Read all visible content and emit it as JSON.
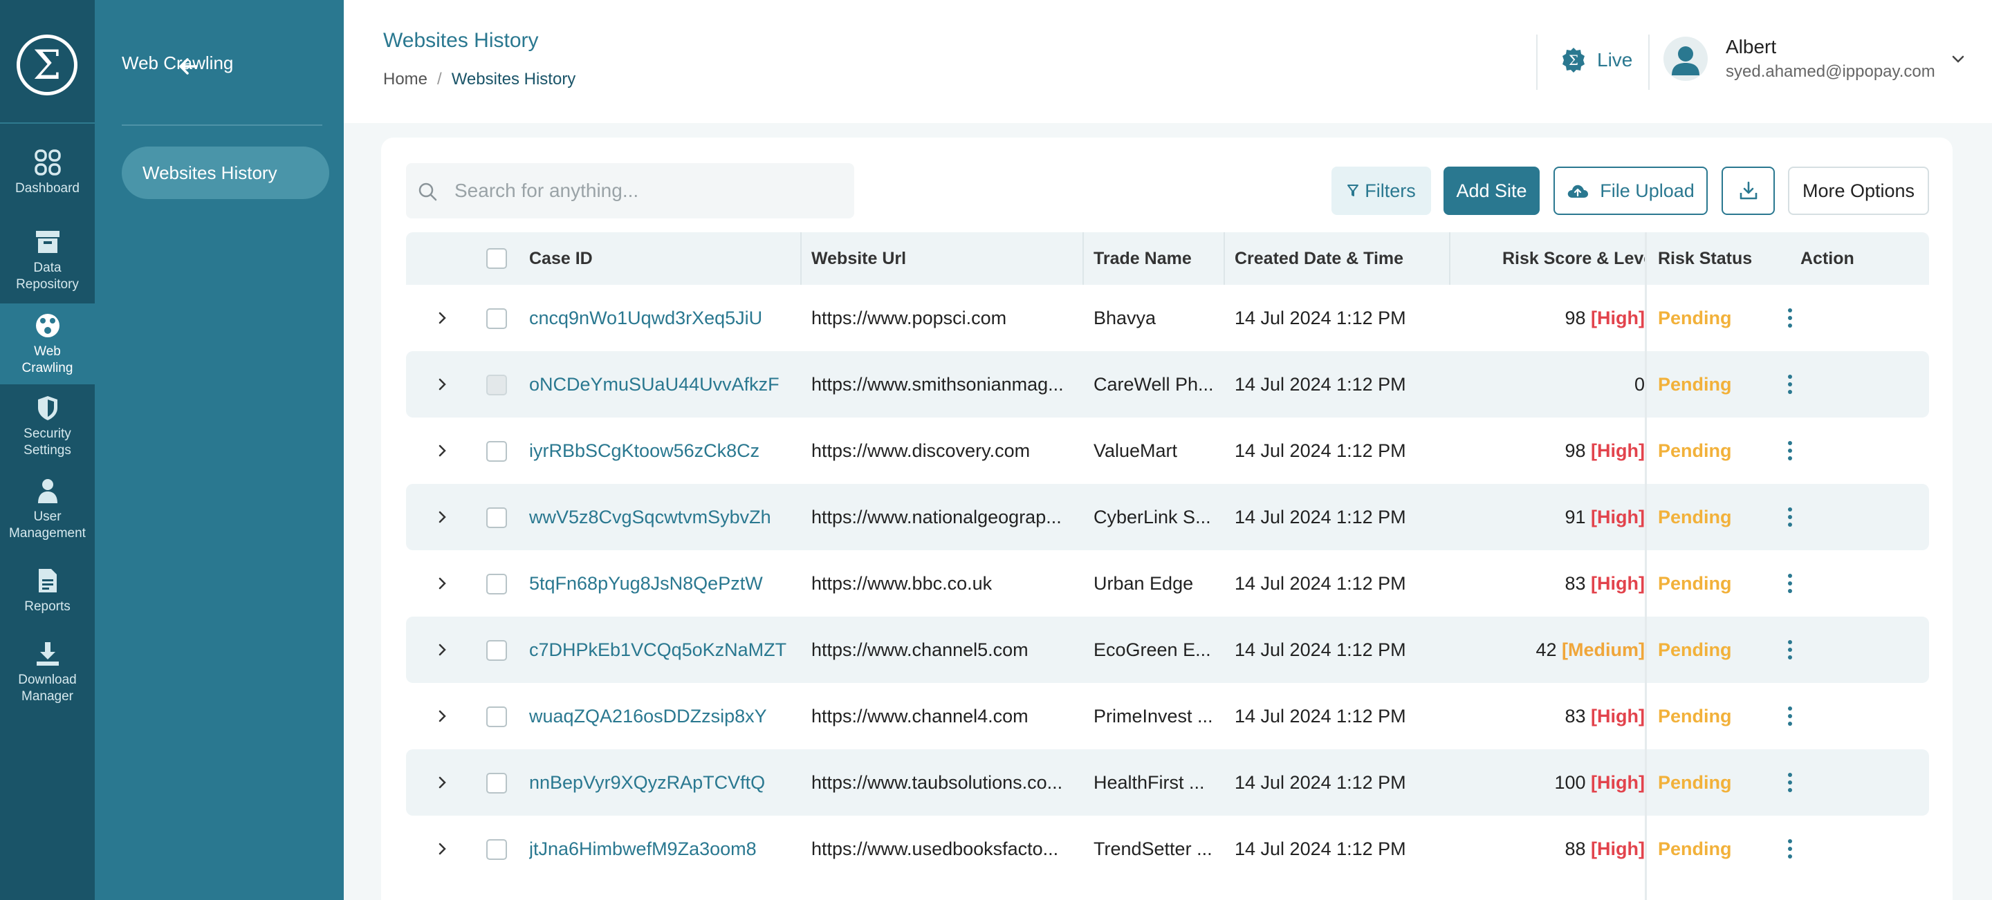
{
  "brand": {
    "logo_glyph": "Σ",
    "accent": "#2a7890",
    "rail_bg": "#1a5468"
  },
  "rail": {
    "items": [
      {
        "label": "Dashboard",
        "icon": "grid-icon"
      },
      {
        "label": "Data Repository",
        "icon": "archive-icon"
      },
      {
        "label": "Web Crawling",
        "icon": "globe-icon",
        "active": true
      },
      {
        "label": "Security Settings",
        "icon": "shield-icon"
      },
      {
        "label": "User Management",
        "icon": "user-icon"
      },
      {
        "label": "Reports",
        "icon": "document-icon"
      },
      {
        "label": "Download Manager",
        "icon": "download-icon"
      }
    ]
  },
  "panel": {
    "title": "Web Crawling",
    "items": [
      {
        "label": "Websites History",
        "active": true
      }
    ]
  },
  "header": {
    "title": "Websites History",
    "breadcrumb": {
      "home": "Home",
      "separator": "/",
      "current": "Websites History"
    },
    "live_label": "Live",
    "user": {
      "name": "Albert",
      "email": "syed.ahamed@ippopay.com"
    }
  },
  "toolbar": {
    "search_placeholder": "Search for anything...",
    "filters_label": "Filters",
    "add_site_label": "Add Site",
    "file_upload_label": "File Upload",
    "more_options_label": "More Options"
  },
  "table": {
    "columns": {
      "case_id": "Case ID",
      "website_url": "Website Url",
      "trade_name": "Trade Name",
      "created": "Created Date & Time",
      "risk": "Risk Score & Level",
      "status": "Risk Status",
      "action": "Action"
    },
    "rows": [
      {
        "case_id": "cncq9nWo1Uqwd3rXeq5JiU",
        "url": "https://www.popsci.com",
        "trade": "Bhavya",
        "created": "14 Jul 2024 1:12 PM",
        "score": "98",
        "level": "[High]",
        "level_kind": "high",
        "status": "Pending"
      },
      {
        "case_id": "oNCDeYmuSUaU44UvvAfkzF",
        "url": "https://www.smithsonianmag...",
        "trade": "CareWell Ph...",
        "created": "14 Jul 2024 1:12 PM",
        "score": "0",
        "level": "",
        "level_kind": "none",
        "status": "Pending",
        "checkbox_disabled": true
      },
      {
        "case_id": "iyrRBbSCgKtoow56zCk8Cz",
        "url": "https://www.discovery.com",
        "trade": "ValueMart",
        "created": "14 Jul 2024 1:12 PM",
        "score": "98",
        "level": "[High]",
        "level_kind": "high",
        "status": "Pending"
      },
      {
        "case_id": "wwV5z8CvgSqcwtvmSybvZh",
        "url": "https://www.nationalgeograp...",
        "trade": "CyberLink S...",
        "created": "14 Jul 2024 1:12 PM",
        "score": "91",
        "level": "[High]",
        "level_kind": "high",
        "status": "Pending"
      },
      {
        "case_id": "5tqFn68pYug8JsN8QePztW",
        "url": "https://www.bbc.co.uk",
        "trade": "Urban Edge",
        "created": "14 Jul 2024 1:12 PM",
        "score": "83",
        "level": "[High]",
        "level_kind": "high",
        "status": "Pending"
      },
      {
        "case_id": "c7DHPkEb1VCQq5oKzNaMZT",
        "url": "https://www.channel5.com",
        "trade": "EcoGreen E...",
        "created": "14 Jul 2024 1:12 PM",
        "score": "42",
        "level": "[Medium]",
        "level_kind": "medium",
        "status": "Pending"
      },
      {
        "case_id": "wuaqZQA216osDDZzsip8xY",
        "url": "https://www.channel4.com",
        "trade": "PrimeInvest ...",
        "created": "14 Jul 2024 1:12 PM",
        "score": "83",
        "level": "[High]",
        "level_kind": "high",
        "status": "Pending"
      },
      {
        "case_id": "nnBepVyr9XQyzRApTCVftQ",
        "url": "https://www.taubsolutions.co...",
        "trade": "HealthFirst ...",
        "created": "14 Jul 2024 1:12 PM",
        "score": "100",
        "level": "[High]",
        "level_kind": "high",
        "status": "Pending"
      },
      {
        "case_id": "jtJna6HimbwefM9Za3oom8",
        "url": "https://www.usedbooksfacto...",
        "trade": "TrendSetter ...",
        "created": "14 Jul 2024 1:12 PM",
        "score": "88",
        "level": "[High]",
        "level_kind": "high",
        "status": "Pending"
      }
    ]
  }
}
